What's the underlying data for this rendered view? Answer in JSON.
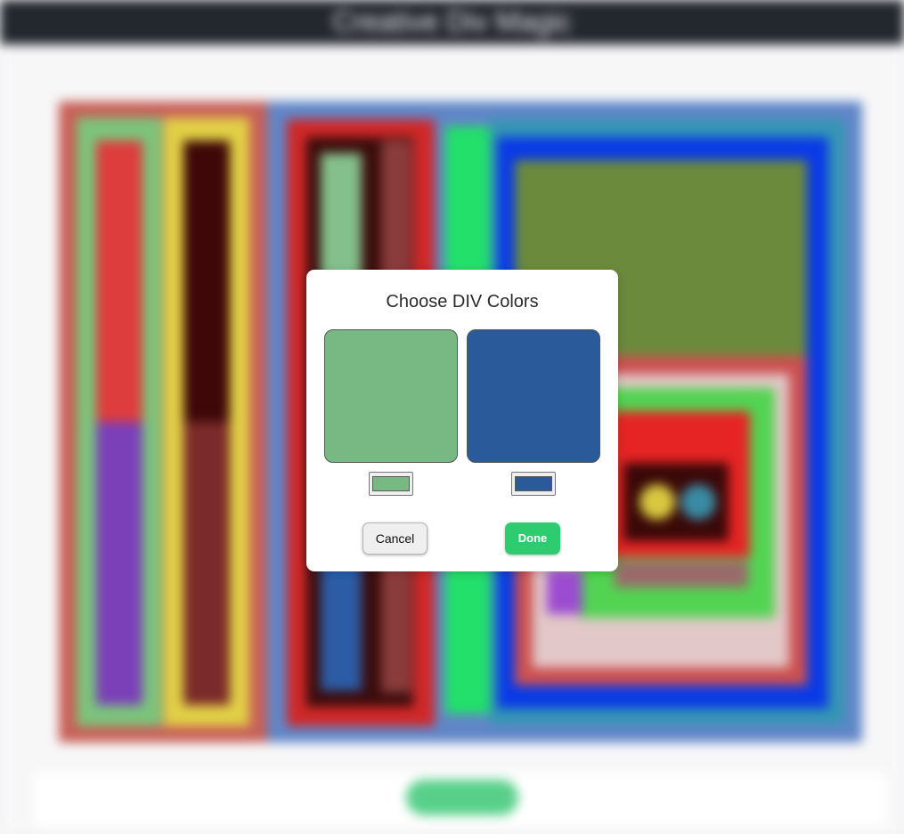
{
  "page": {
    "title": "Creative Div Magic",
    "bottom_button_label": ""
  },
  "modal": {
    "title": "Choose DIV Colors",
    "color_left": "#78b882",
    "color_right": "#2a5a9a",
    "cancel_label": "Cancel",
    "done_label": "Done",
    "done_color": "#2ecc71"
  }
}
